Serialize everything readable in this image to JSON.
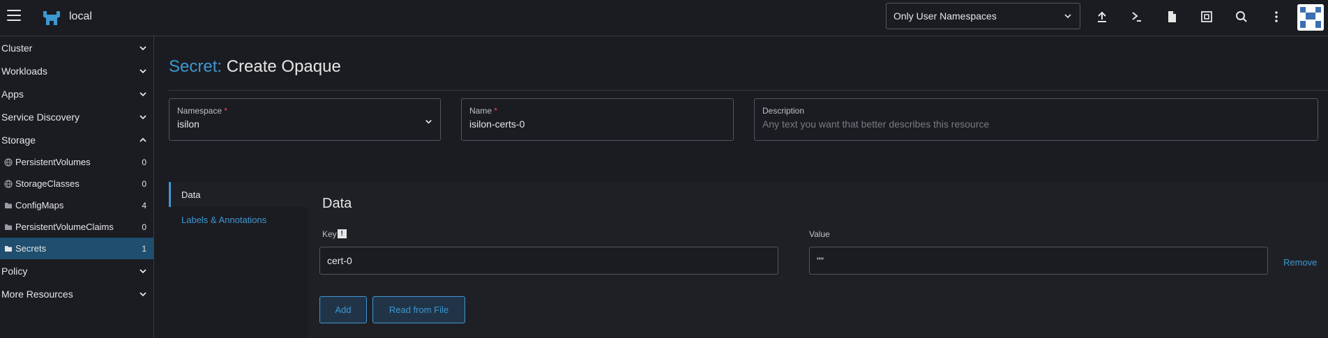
{
  "topbar": {
    "cluster_name": "local",
    "namespace_filter": "Only User Namespaces",
    "icons": [
      "upload-icon",
      "terminal-icon",
      "file-icon",
      "copy-icon",
      "search-icon",
      "more-icon"
    ]
  },
  "sidebar": {
    "groups": {
      "cluster": "Cluster",
      "workloads": "Workloads",
      "apps": "Apps",
      "service_discovery": "Service Discovery",
      "storage": "Storage",
      "policy": "Policy",
      "more_resources": "More Resources"
    },
    "storage_items": [
      {
        "label": "PersistentVolumes",
        "count": "0",
        "icon": "globe-icon"
      },
      {
        "label": "StorageClasses",
        "count": "0",
        "icon": "globe-icon"
      },
      {
        "label": "ConfigMaps",
        "count": "4",
        "icon": "folder-icon"
      },
      {
        "label": "PersistentVolumeClaims",
        "count": "0",
        "icon": "folder-icon"
      },
      {
        "label": "Secrets",
        "count": "1",
        "icon": "folder-icon"
      }
    ]
  },
  "main": {
    "title_prefix": "Secret:",
    "title": "Create Opaque",
    "namespace": {
      "label": "Namespace",
      "required": "*",
      "value": "isilon"
    },
    "name": {
      "label": "Name",
      "required": "*",
      "value": "isilon-certs-0"
    },
    "description": {
      "label": "Description",
      "placeholder": "Any text you want that better describes this resource"
    },
    "tabs": {
      "data": "Data",
      "labels": "Labels & Annotations"
    },
    "data_section": {
      "title": "Data",
      "key_label": "Key",
      "info_glyph": "!",
      "value_label": "Value",
      "key_value": "cert-0",
      "value_value": "\"\"",
      "remove": "Remove",
      "add": "Add",
      "read_file": "Read from File"
    }
  },
  "colors": {
    "accent": "#3d98d3",
    "active_nav": "#1f4e6f",
    "background": "#1b1c21",
    "required": "#f64747"
  }
}
